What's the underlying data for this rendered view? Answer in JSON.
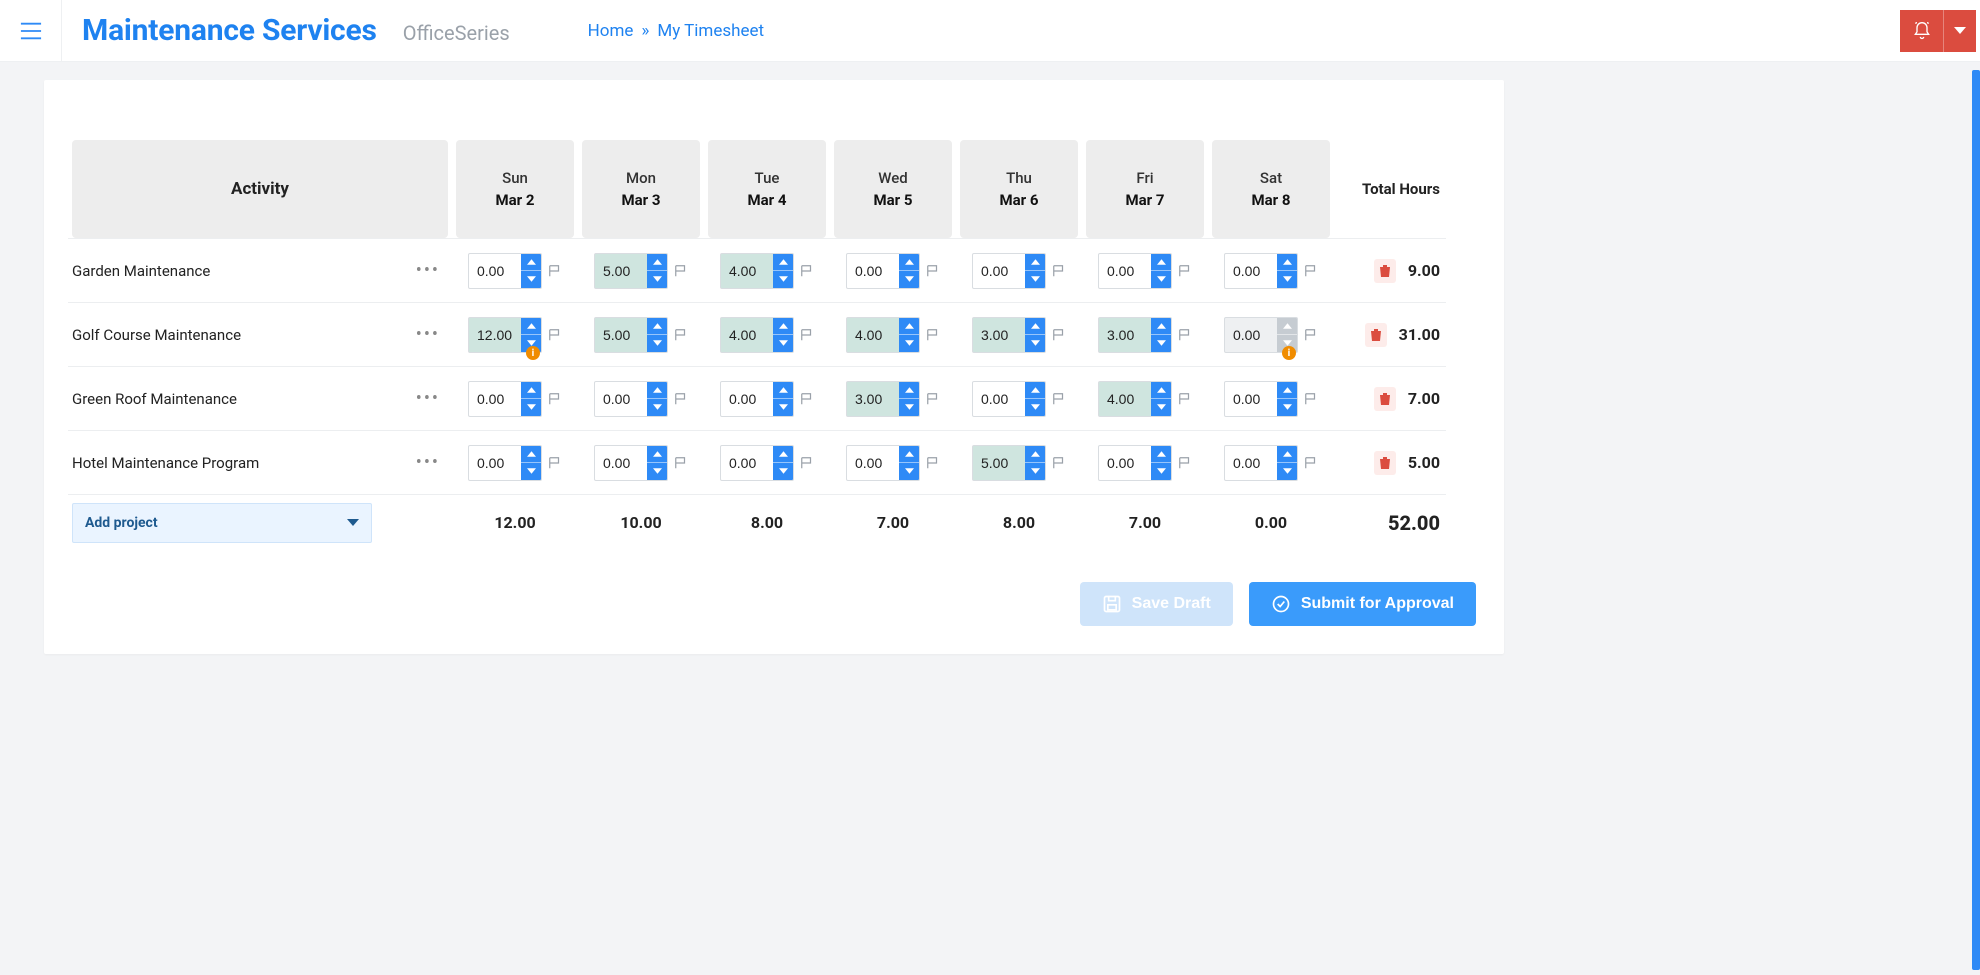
{
  "header": {
    "brand_main": "Maintenance Services",
    "brand_sub": "OfficeSeries",
    "crumb_home": "Home",
    "crumb_sep": "»",
    "crumb_current": "My Timesheet"
  },
  "columns": {
    "activity": "Activity",
    "total": "Total Hours",
    "days": [
      {
        "dow": "Sun",
        "date": "Mar 2"
      },
      {
        "dow": "Mon",
        "date": "Mar 3"
      },
      {
        "dow": "Tue",
        "date": "Mar 4"
      },
      {
        "dow": "Wed",
        "date": "Mar 5"
      },
      {
        "dow": "Thu",
        "date": "Mar 6"
      },
      {
        "dow": "Fri",
        "date": "Mar 7"
      },
      {
        "dow": "Sat",
        "date": "Mar 8"
      }
    ]
  },
  "rows": [
    {
      "name": "Garden Maintenance",
      "total": "9.00",
      "cells": [
        {
          "value": "0.00",
          "hl": false,
          "muted": false,
          "warn": false
        },
        {
          "value": "5.00",
          "hl": true,
          "muted": false,
          "warn": false
        },
        {
          "value": "4.00",
          "hl": true,
          "muted": false,
          "warn": false
        },
        {
          "value": "0.00",
          "hl": false,
          "muted": false,
          "warn": false
        },
        {
          "value": "0.00",
          "hl": false,
          "muted": false,
          "warn": false
        },
        {
          "value": "0.00",
          "hl": false,
          "muted": false,
          "warn": false
        },
        {
          "value": "0.00",
          "hl": false,
          "muted": false,
          "warn": false
        }
      ]
    },
    {
      "name": "Golf Course Maintenance",
      "total": "31.00",
      "cells": [
        {
          "value": "12.00",
          "hl": true,
          "muted": false,
          "warn": true
        },
        {
          "value": "5.00",
          "hl": true,
          "muted": false,
          "warn": false
        },
        {
          "value": "4.00",
          "hl": true,
          "muted": false,
          "warn": false
        },
        {
          "value": "4.00",
          "hl": true,
          "muted": false,
          "warn": false
        },
        {
          "value": "3.00",
          "hl": true,
          "muted": false,
          "warn": false
        },
        {
          "value": "3.00",
          "hl": true,
          "muted": false,
          "warn": false
        },
        {
          "value": "0.00",
          "hl": false,
          "muted": true,
          "warn": true
        }
      ]
    },
    {
      "name": "Green Roof Maintenance",
      "total": "7.00",
      "cells": [
        {
          "value": "0.00",
          "hl": false,
          "muted": false,
          "warn": false
        },
        {
          "value": "0.00",
          "hl": false,
          "muted": false,
          "warn": false
        },
        {
          "value": "0.00",
          "hl": false,
          "muted": false,
          "warn": false
        },
        {
          "value": "3.00",
          "hl": true,
          "muted": false,
          "warn": false
        },
        {
          "value": "0.00",
          "hl": false,
          "muted": false,
          "warn": false
        },
        {
          "value": "4.00",
          "hl": true,
          "muted": false,
          "warn": false
        },
        {
          "value": "0.00",
          "hl": false,
          "muted": false,
          "warn": false
        }
      ]
    },
    {
      "name": "Hotel Maintenance Program",
      "total": "5.00",
      "cells": [
        {
          "value": "0.00",
          "hl": false,
          "muted": false,
          "warn": false
        },
        {
          "value": "0.00",
          "hl": false,
          "muted": false,
          "warn": false
        },
        {
          "value": "0.00",
          "hl": false,
          "muted": false,
          "warn": false
        },
        {
          "value": "0.00",
          "hl": false,
          "muted": false,
          "warn": false
        },
        {
          "value": "5.00",
          "hl": true,
          "muted": false,
          "warn": false
        },
        {
          "value": "0.00",
          "hl": false,
          "muted": false,
          "warn": false
        },
        {
          "value": "0.00",
          "hl": false,
          "muted": false,
          "warn": false
        }
      ]
    }
  ],
  "footer": {
    "add_project": "Add project",
    "day_totals": [
      "12.00",
      "10.00",
      "8.00",
      "7.00",
      "8.00",
      "7.00",
      "0.00"
    ],
    "grand_total": "52.00"
  },
  "actions": {
    "save_draft": "Save Draft",
    "submit": "Submit for Approval"
  }
}
